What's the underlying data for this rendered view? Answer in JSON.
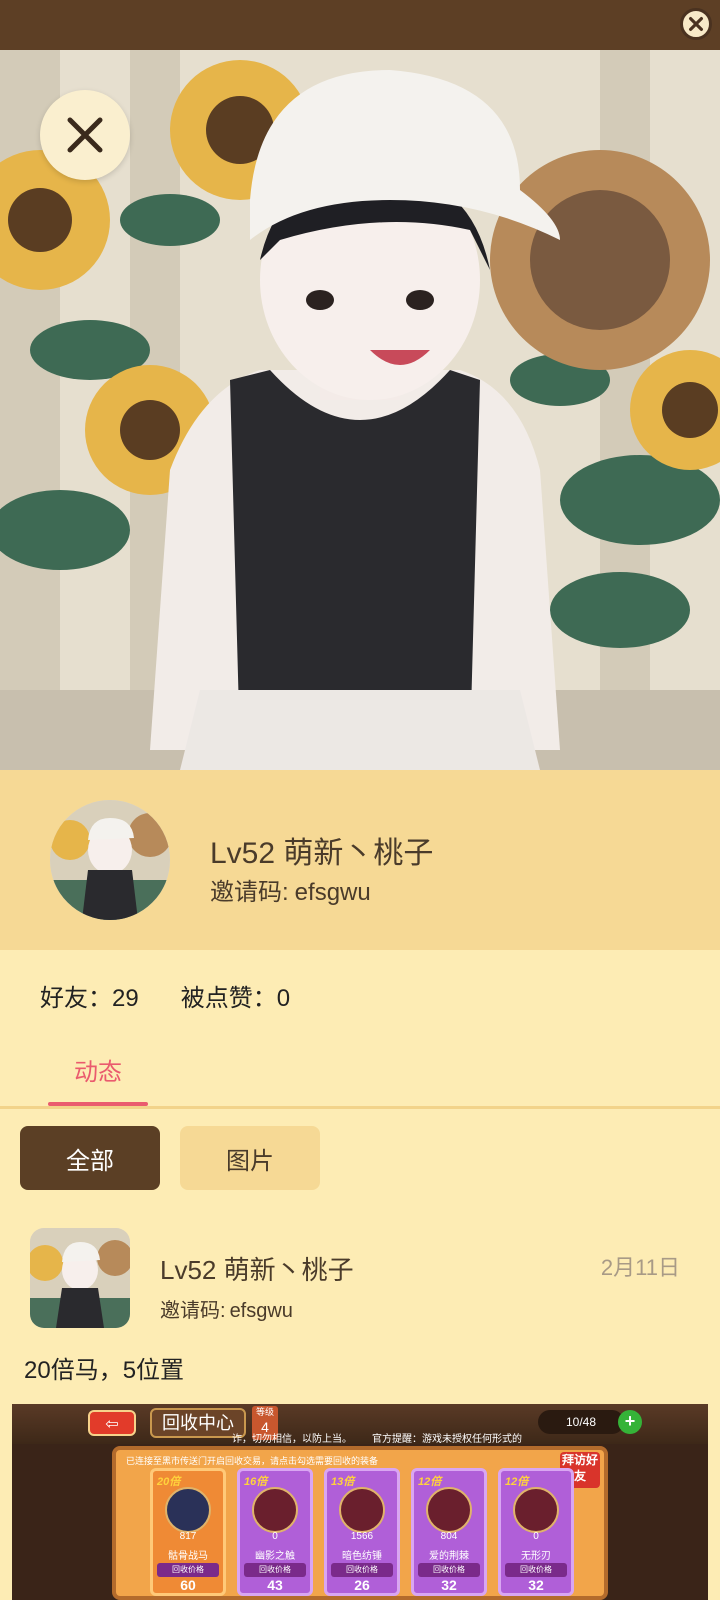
{
  "profile": {
    "name": "Lv52 萌新丶桃子",
    "invite_label": "邀请码:",
    "invite_code": "efsgwu"
  },
  "stats": {
    "friends_label": "好友：",
    "friends_count": "29",
    "likes_label": "被点赞：",
    "likes_count": "0"
  },
  "tabs": [
    {
      "label": "动态"
    }
  ],
  "filters": {
    "all": "全部",
    "images": "图片"
  },
  "post": {
    "name": "Lv52 萌新丶桃子",
    "invite_label": "邀请码:",
    "invite_code": "efsgwu",
    "date": "2月11日",
    "text": "20倍马，5位置"
  },
  "game_screenshot": {
    "back_label": "⇦",
    "title": "回收中心",
    "level_label": "等级",
    "level_value": "4",
    "hint_left": "诈，切勿相信，以防上当。",
    "hint_right": "官方提醒：游戏未授权任何形式的",
    "count": "10/48",
    "panel_header": "已连接至黑市传送门开启回收交易，请点击勾选需要回收的装备",
    "visit_label": "拜访好友",
    "price_label": "回收价格",
    "items": [
      {
        "multiplier": "20倍",
        "count": "817",
        "name": "骷骨战马",
        "price": "60"
      },
      {
        "multiplier": "16倍",
        "count": "0",
        "name": "幽影之触",
        "price": "43"
      },
      {
        "multiplier": "13倍",
        "count": "1566",
        "name": "暗色纺锤",
        "price": "26"
      },
      {
        "multiplier": "12倍",
        "count": "804",
        "name": "爱的荆棘",
        "price": "32"
      },
      {
        "multiplier": "12倍",
        "count": "0",
        "name": "无形刃",
        "price": "32"
      }
    ]
  },
  "colors": {
    "header_brown": "#5d3f25",
    "profile_band": "#f6d995",
    "page_bg": "#fdecb4",
    "accent_pink": "#ea5b6e"
  },
  "icons": [
    "close-icon",
    "close-x-icon"
  ]
}
